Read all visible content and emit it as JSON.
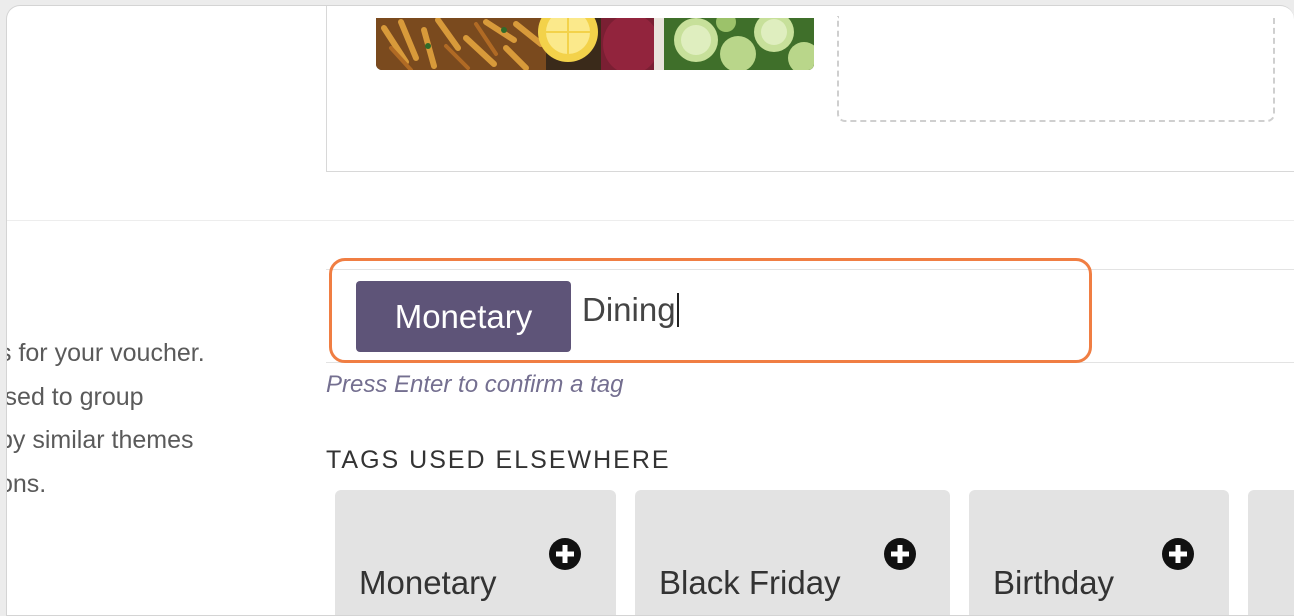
{
  "description_lines": [
    "s for your voucher.",
    "ised to group",
    "by similar themes",
    "ons."
  ],
  "tag_input": {
    "selected_tag": "Monetary",
    "typed_value": "Dining",
    "hint": "Press Enter to confirm a tag"
  },
  "suggestions": {
    "heading": "TAGS USED ELSEWHERE",
    "items": [
      {
        "label": "Monetary"
      },
      {
        "label": "Black Friday"
      },
      {
        "label": "Birthday"
      }
    ]
  },
  "colors": {
    "chip": "#5e5478",
    "highlight": "#f07e43",
    "hint": "#746f90"
  },
  "icons": {
    "add": "plus-circle-icon"
  }
}
